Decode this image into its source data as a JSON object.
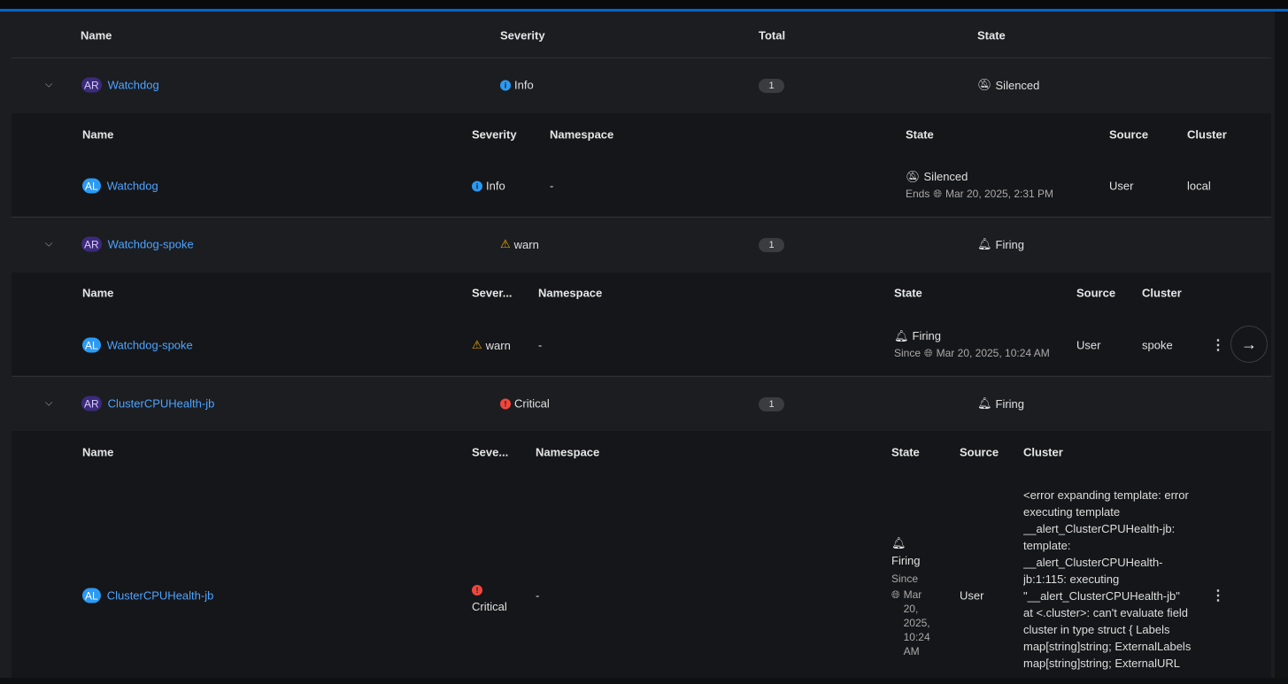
{
  "columns": {
    "name": "Name",
    "severity": "Severity",
    "total": "Total",
    "state": "State"
  },
  "child_columns": {
    "name": "Name",
    "severity": "Severity",
    "severity_trunc": "Sever...",
    "severity_trunc2": "Seve...",
    "namespace": "Namespace",
    "state": "State",
    "source": "Source",
    "cluster": "Cluster"
  },
  "groups": [
    {
      "badge": "AR",
      "name": "Watchdog",
      "severity": "Info",
      "total": "1",
      "state": "Silenced",
      "alert": {
        "badge": "AL",
        "name": "Watchdog",
        "severity": "Info",
        "namespace": "-",
        "state": "Silenced",
        "time_prefix": "Ends",
        "time": "Mar 20, 2025, 2:31 PM",
        "source": "User",
        "cluster": "local"
      }
    },
    {
      "badge": "AR",
      "name": "Watchdog-spoke",
      "severity": "warn",
      "total": "1",
      "state": "Firing",
      "alert": {
        "badge": "AL",
        "name": "Watchdog-spoke",
        "severity": "warn",
        "namespace": "-",
        "state": "Firing",
        "time_prefix": "Since",
        "time": "Mar 20, 2025, 10:24 AM",
        "source": "User",
        "cluster": "spoke"
      }
    },
    {
      "badge": "AR",
      "name": "ClusterCPUHealth-jb",
      "severity": "Critical",
      "total": "1",
      "state": "Firing",
      "alert": {
        "badge": "AL",
        "name": "ClusterCPUHealth-jb",
        "severity": "Critical",
        "namespace": "-",
        "state": "Firing",
        "time_prefix": "Since",
        "time_lines": [
          "Mar",
          "20,",
          "2025,",
          "10:24",
          "AM"
        ],
        "source": "User",
        "cluster": "<error expanding template: error executing template __alert_ClusterCPUHealth-jb: template: __alert_ClusterCPUHealth-jb:1:115: executing \"__alert_ClusterCPUHealth-jb\" at <.cluster>: can't evaluate field cluster in type struct { Labels map[string]string; ExternalLabels map[string]string; ExternalURL"
      }
    }
  ],
  "colors": {
    "accent": "#0066cc",
    "link": "#4da3ff",
    "info": "#2b9af3",
    "warn": "#f0ab00",
    "critical": "#f0463c"
  }
}
